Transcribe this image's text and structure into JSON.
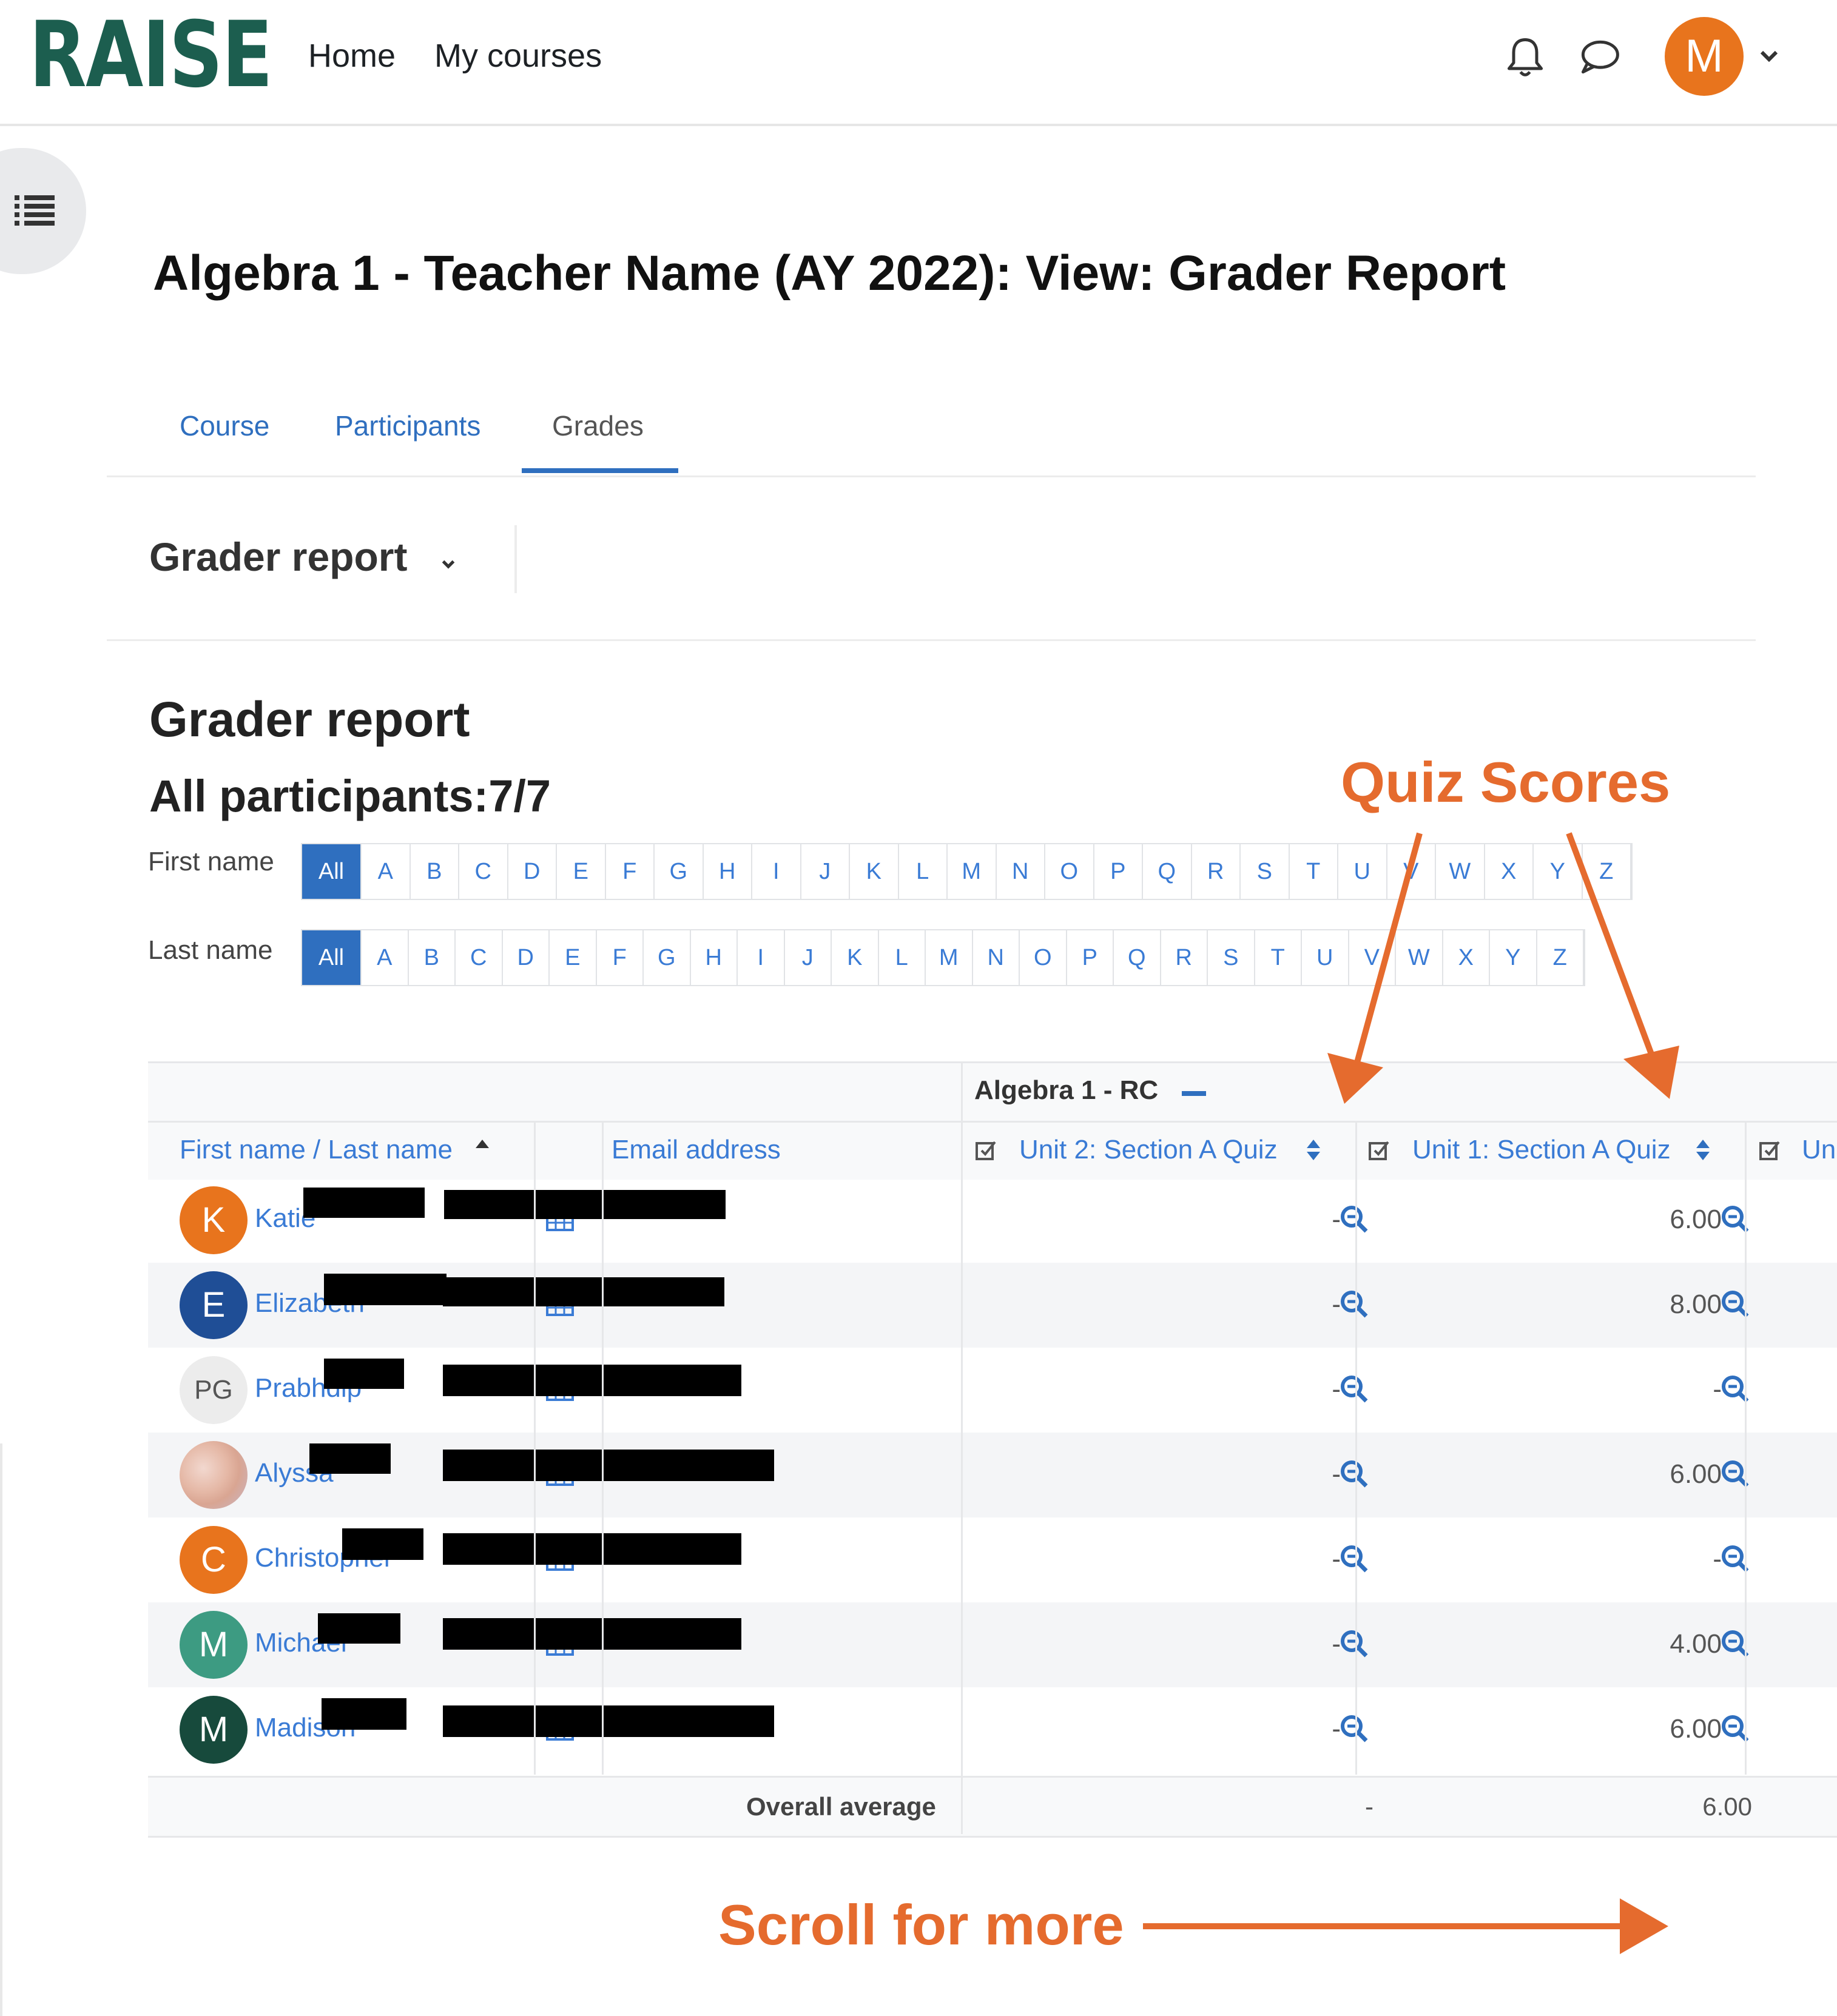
{
  "navbar": {
    "logo": "RAISE",
    "links": [
      "Home",
      "My courses"
    ],
    "avatar_initial": "M"
  },
  "page_title": "Algebra 1 - Teacher Name (AY 2022): View: Grader Report",
  "tabs": [
    {
      "label": "Course",
      "active": false
    },
    {
      "label": "Participants",
      "active": false
    },
    {
      "label": "Grades",
      "active": true
    }
  ],
  "report_selector": "Grader report",
  "report_heading": "Grader report",
  "participants_heading": "All participants:7/7",
  "initials": {
    "first_label": "First name",
    "last_label": "Last name",
    "all_label": "All",
    "letters": [
      "A",
      "B",
      "C",
      "D",
      "E",
      "F",
      "G",
      "H",
      "I",
      "J",
      "K",
      "L",
      "M",
      "N",
      "O",
      "P",
      "Q",
      "R",
      "S",
      "T",
      "U",
      "V",
      "W",
      "X",
      "Y",
      "Z"
    ]
  },
  "table": {
    "category": "Algebra 1 - RC",
    "columns": {
      "name": "First name / Last name",
      "email": "Email address",
      "quiz1": "Unit 2: Section A Quiz",
      "quiz2": "Unit 1: Section A Quiz",
      "quiz3": "Un"
    },
    "rows": [
      {
        "initial": "K",
        "name": "Katie",
        "avatar_color": "#e8741d",
        "quiz1": "-",
        "quiz2": "6.00"
      },
      {
        "initial": "E",
        "name": "Elizabeth",
        "avatar_color": "#1f4e96",
        "quiz1": "-",
        "quiz2": "8.00"
      },
      {
        "initial": "PG",
        "name": "Prabhdip",
        "avatar_color": "#ececec",
        "quiz1": "-",
        "quiz2": "-"
      },
      {
        "initial": "",
        "name": "Alyssa",
        "avatar_color": "photo",
        "quiz1": "-",
        "quiz2": "6.00"
      },
      {
        "initial": "C",
        "name": "Christopher",
        "avatar_color": "#e8741d",
        "quiz1": "-",
        "quiz2": "-"
      },
      {
        "initial": "M",
        "name": "Michael",
        "avatar_color": "#3d9b82",
        "quiz1": "-",
        "quiz2": "4.00"
      },
      {
        "initial": "M",
        "name": "Madison",
        "avatar_color": "#174a3c",
        "quiz1": "-",
        "quiz2": "6.00"
      }
    ],
    "overall_label": "Overall average",
    "overall_quiz1": "-",
    "overall_quiz2": "6.00"
  },
  "annotations": {
    "quiz_scores": "Quiz Scores",
    "scroll_more": "Scroll for more",
    "color": "#e56b2e"
  }
}
